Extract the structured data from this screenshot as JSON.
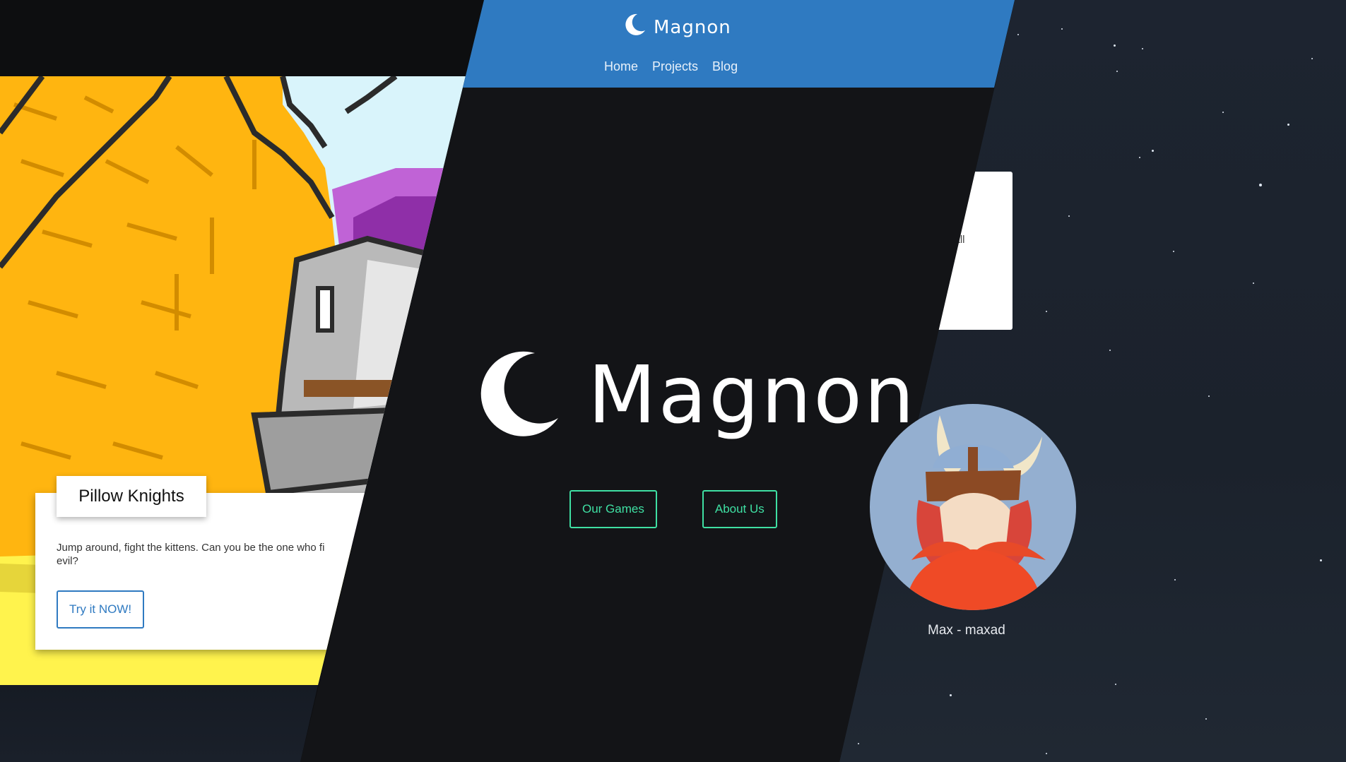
{
  "site": {
    "brand_name": "Magnon",
    "nav": {
      "items": [
        {
          "label": "Home"
        },
        {
          "label": "Projects"
        },
        {
          "label": "Blog"
        }
      ]
    }
  },
  "hero": {
    "title": "Magnon",
    "buttons": {
      "our_games": "Our Games",
      "about_us": "About Us"
    }
  },
  "game_card": {
    "title": "Pillow Knights",
    "description": "Jump around, fight the kittens. Can you be the one who f… evil?",
    "description_line1": "Jump around, fight the kittens. Can you be the one who fi",
    "description_line2": "evil?",
    "cta": "Try it NOW!"
  },
  "right_card": {
    "text_fragment": "n all"
  },
  "team_member": {
    "name": "Max - maxad"
  },
  "colors": {
    "navbar": "#2f7ac1",
    "accent_green": "#3fe0a3",
    "background_dark": "#131417",
    "card_button_blue": "#2f7ac1"
  },
  "icons": {
    "brand_logo": "crescent-moon-icon",
    "member_avatar": "viking-avatar"
  }
}
